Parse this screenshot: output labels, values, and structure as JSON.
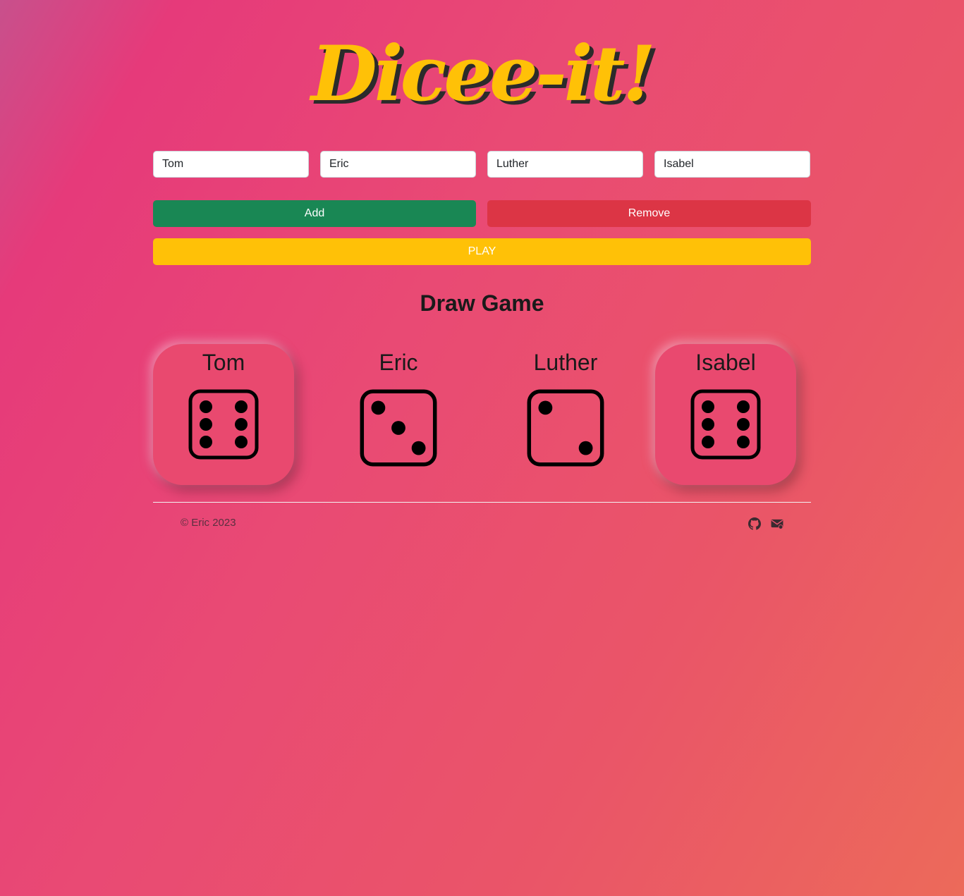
{
  "app": {
    "title": "Dicee-it!"
  },
  "players_inputs": [
    {
      "value": "Tom"
    },
    {
      "value": "Eric"
    },
    {
      "value": "Luther"
    },
    {
      "value": "Isabel"
    }
  ],
  "buttons": {
    "add": "Add",
    "remove": "Remove",
    "play": "PLAY"
  },
  "result": "Draw Game",
  "players": [
    {
      "name": "Tom",
      "roll": 6,
      "winner": true
    },
    {
      "name": "Eric",
      "roll": 3,
      "winner": false
    },
    {
      "name": "Luther",
      "roll": 2,
      "winner": false
    },
    {
      "name": "Isabel",
      "roll": 6,
      "winner": true
    }
  ],
  "footer": {
    "copyright": "© Eric 2023",
    "icons": [
      "github-icon",
      "mail-icon"
    ]
  },
  "colors": {
    "accent": "#ffc107",
    "add": "#198754",
    "remove": "#dc3545"
  }
}
